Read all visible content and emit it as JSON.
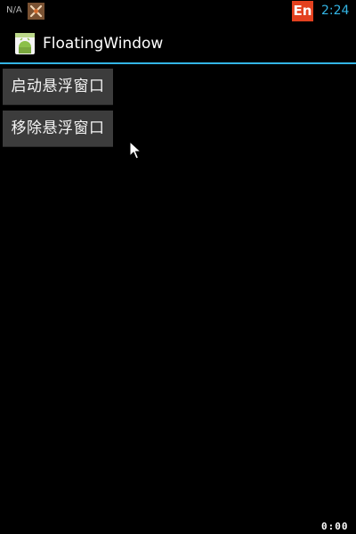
{
  "status_bar": {
    "carrier": "N/A",
    "notification_icon": "app-notification-icon",
    "ime_label": "En",
    "clock": "2:24",
    "colors": {
      "clock": "#33b5e5",
      "ime_badge": "#e3411f"
    }
  },
  "action_bar": {
    "title": "FloatingWindow",
    "icon": "android-app-icon",
    "divider_color": "#33b5e5"
  },
  "buttons": {
    "start_floating": "启动悬浮窗口",
    "remove_floating": "移除悬浮窗口"
  },
  "corner_counter": "0:00",
  "pointer": "mouse-cursor-icon"
}
